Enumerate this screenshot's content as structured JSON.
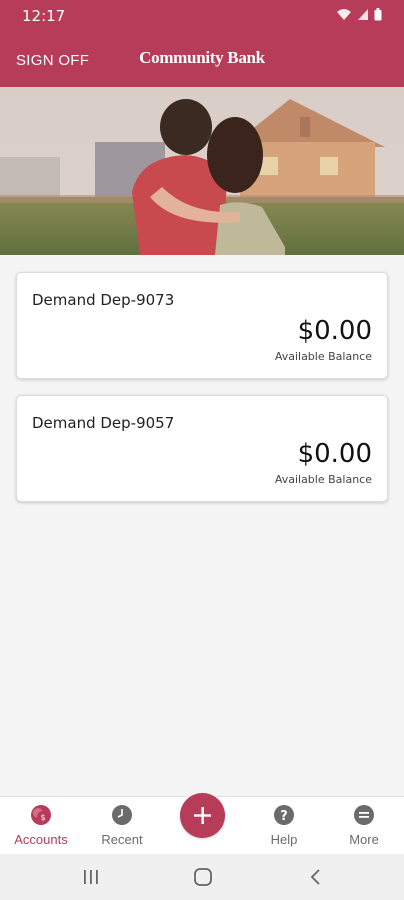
{
  "status_bar": {
    "time": "12:17",
    "icons": [
      "wifi-icon",
      "signal-icon",
      "battery-icon"
    ]
  },
  "header": {
    "sign_off_label": "SIGN OFF",
    "brand": "Community Bank"
  },
  "hero": {
    "image": "couple-embracing-looking-at-house-photo"
  },
  "accounts": [
    {
      "name": "Demand Dep-9073",
      "balance": "$0.00",
      "balance_label": "Available Balance"
    },
    {
      "name": "Demand Dep-9057",
      "balance": "$0.00",
      "balance_label": "Available Balance"
    }
  ],
  "tab_bar": {
    "items": [
      {
        "label": "Accounts",
        "icon": "accounts-icon",
        "active": true
      },
      {
        "label": "Recent",
        "icon": "clock-icon",
        "active": false
      },
      {
        "label": "Help",
        "icon": "help-icon",
        "active": false
      },
      {
        "label": "More",
        "icon": "more-icon",
        "active": false
      }
    ],
    "center_action_icon": "plus-icon"
  },
  "system_nav": {
    "buttons": [
      "recent-apps-icon",
      "home-icon",
      "back-icon"
    ]
  },
  "colors": {
    "brand": "#b73c5a",
    "background": "#f4f4f4",
    "inactive": "#6b6b6b"
  }
}
